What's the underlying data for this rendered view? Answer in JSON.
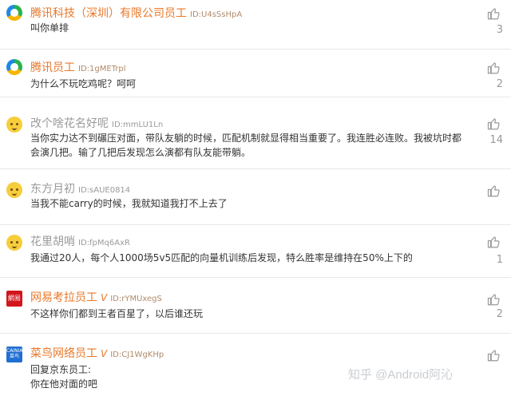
{
  "comments": [
    {
      "name": "腾讯科技（深圳）有限公司员工",
      "uid": "ID:U4sSsHpA",
      "verified": "",
      "text": "叫你单排",
      "likes": "3",
      "name_color": "orange",
      "avatar": "tencent"
    },
    {
      "name": "腾讯员工",
      "uid": "ID:1gMETrpl",
      "verified": "",
      "text": "为什么不玩吃鸡呢？呵呵",
      "likes": "2",
      "name_color": "orange",
      "avatar": "tencent"
    },
    {
      "name": "改个啥花名好呢",
      "uid": "ID:mmLU1Ln",
      "verified": "",
      "text": "当你实力达不到碾压对面，带队友躺的时候，匹配机制就显得相当重要了。我连胜必连败。我被坑时都会演几把。输了几把后发现怎么演都有队友能带躺。",
      "likes": "14",
      "name_color": "gray",
      "avatar": "anon"
    },
    {
      "name": "东方月初",
      "uid": "ID:sAUE0814",
      "verified": "",
      "text": "当我不能carry的时候，我就知道我打不上去了",
      "likes": "",
      "name_color": "gray",
      "avatar": "anon"
    },
    {
      "name": "花里胡哨",
      "uid": "ID:fpMq6AxR",
      "verified": "",
      "text": "我通过20人，每个人1000场5v5匹配的向量机训练后发现，特么胜率是维持在50%上下的",
      "likes": "1",
      "name_color": "gray",
      "avatar": "anon"
    },
    {
      "name": "网易考拉员工",
      "uid": "ID:rYMUxegS",
      "verified": "V",
      "text": "不这样你们都到王者百星了，以后谁还玩",
      "likes": "2",
      "name_color": "orange",
      "avatar": "netease",
      "avatar_text": "網易"
    },
    {
      "name": "菜鸟网络员工",
      "uid": "ID:CJ1WgKHp",
      "verified": "V",
      "text": "回复京东员工:",
      "text2": "你在他对面的吧",
      "likes": "",
      "name_color": "orange",
      "avatar": "cainiao",
      "avatar_text": "CAINIAO 菜鸟"
    }
  ],
  "watermark": "知乎 @Android阿沁",
  "icons": {
    "like": "thumbs-up-icon"
  }
}
